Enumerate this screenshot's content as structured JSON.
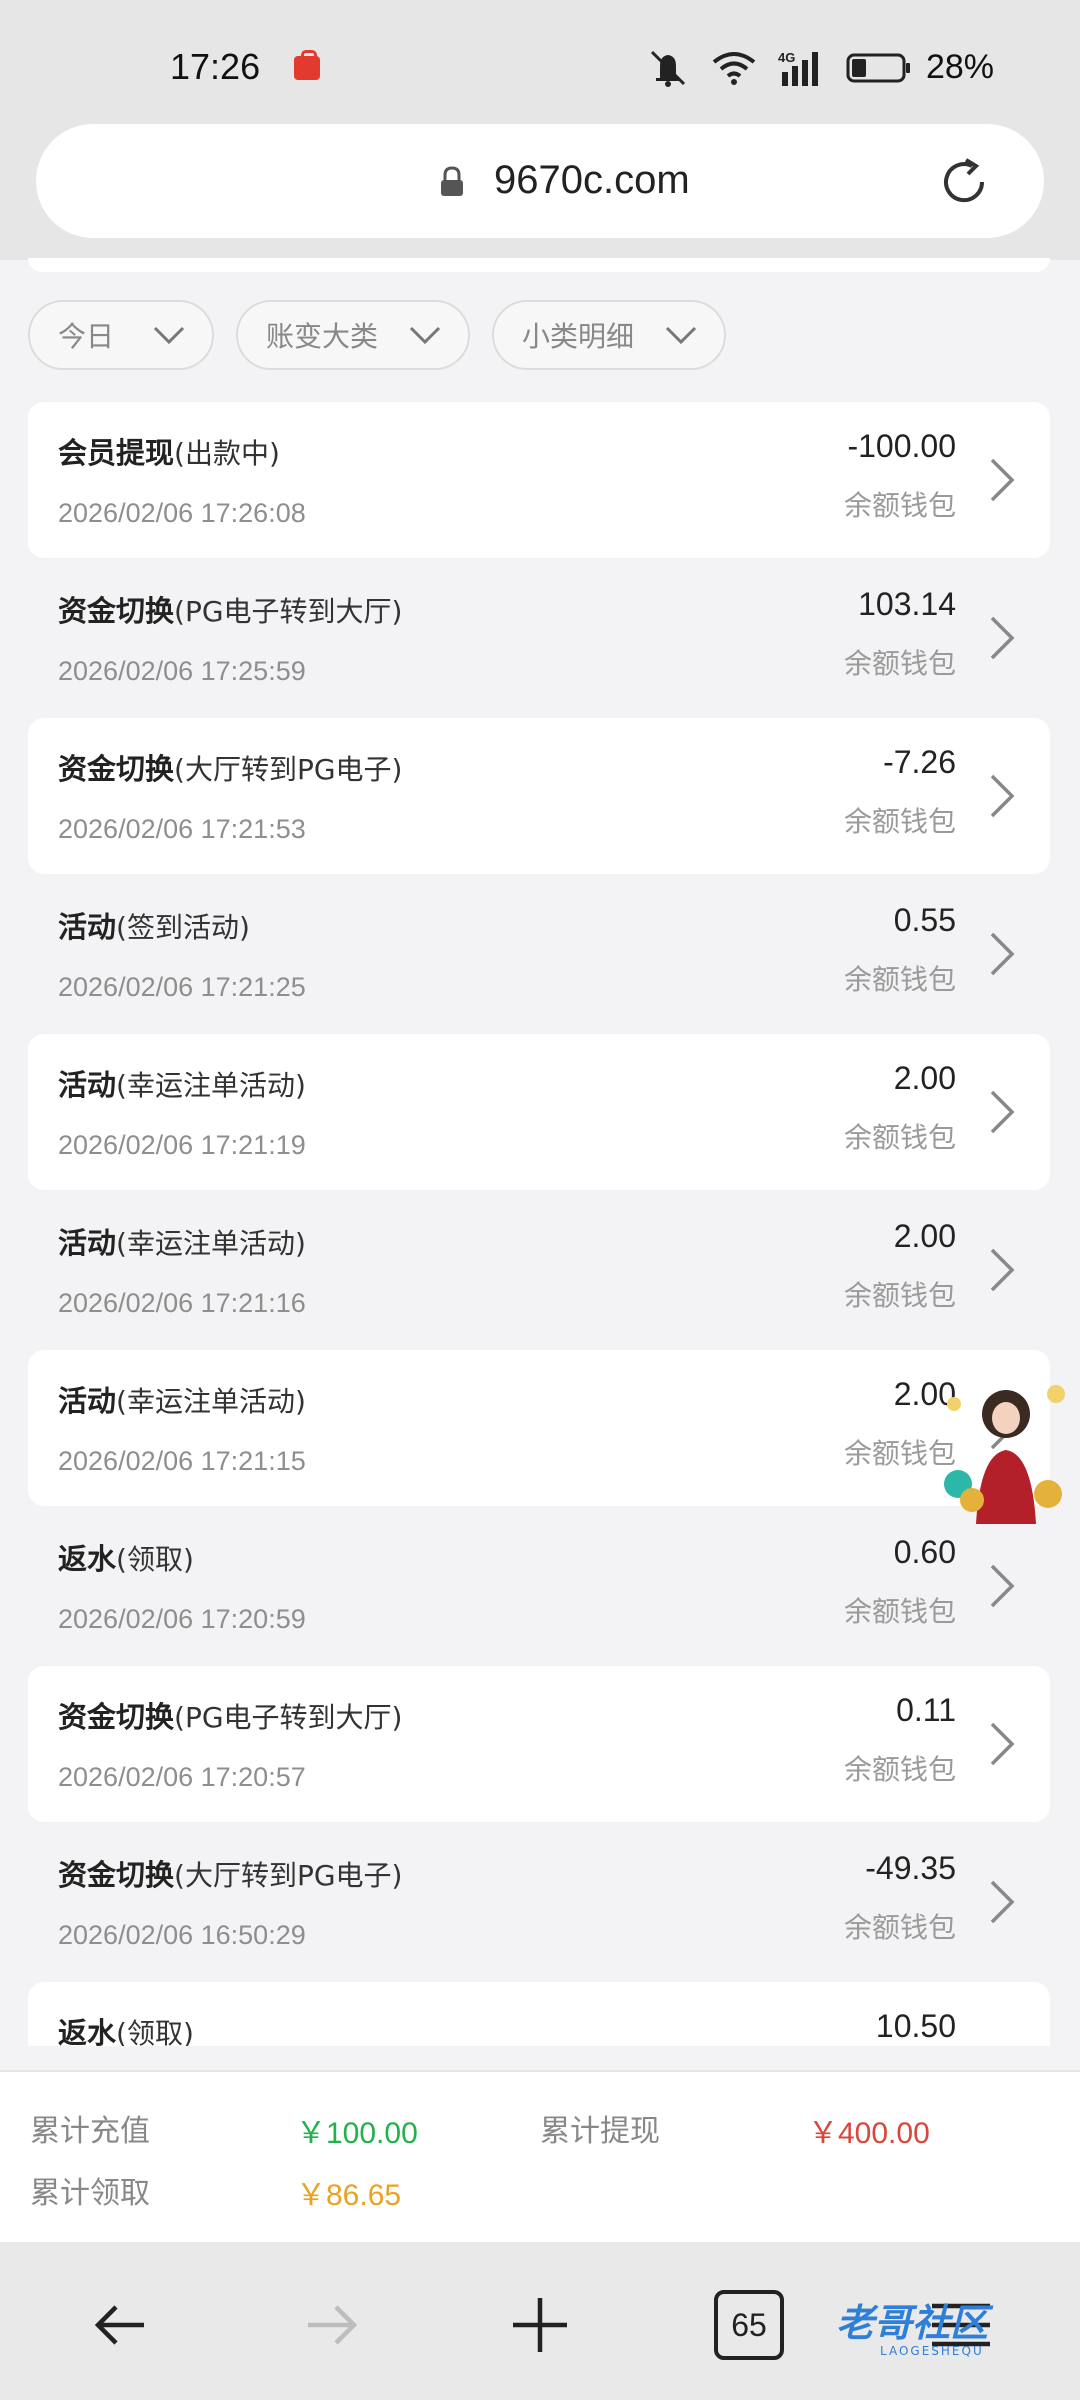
{
  "status_bar": {
    "time": "17:26",
    "battery": "28%",
    "network": "4G"
  },
  "browser": {
    "url": "9670c.com",
    "tab_count": "65"
  },
  "filters": [
    {
      "label": "今日"
    },
    {
      "label": "账变大类"
    },
    {
      "label": "小类明细"
    }
  ],
  "records": [
    {
      "title": "会员提现",
      "sub": "(出款中)",
      "date": "2026/02/06 17:26:08",
      "amount": "-100.00",
      "wallet": "余额钱包"
    },
    {
      "title": "资金切换",
      "sub": "(PG电子转到大厅)",
      "date": "2026/02/06 17:25:59",
      "amount": "103.14",
      "wallet": "余额钱包"
    },
    {
      "title": "资金切换",
      "sub": "(大厅转到PG电子)",
      "date": "2026/02/06 17:21:53",
      "amount": "-7.26",
      "wallet": "余额钱包"
    },
    {
      "title": "活动",
      "sub": "(签到活动)",
      "date": "2026/02/06 17:21:25",
      "amount": "0.55",
      "wallet": "余额钱包"
    },
    {
      "title": "活动",
      "sub": "(幸运注单活动)",
      "date": "2026/02/06 17:21:19",
      "amount": "2.00",
      "wallet": "余额钱包"
    },
    {
      "title": "活动",
      "sub": "(幸运注单活动)",
      "date": "2026/02/06 17:21:16",
      "amount": "2.00",
      "wallet": "余额钱包"
    },
    {
      "title": "活动",
      "sub": "(幸运注单活动)",
      "date": "2026/02/06 17:21:15",
      "amount": "2.00",
      "wallet": "余额钱包"
    },
    {
      "title": "返水",
      "sub": "(领取)",
      "date": "2026/02/06 17:20:59",
      "amount": "0.60",
      "wallet": "余额钱包"
    },
    {
      "title": "资金切换",
      "sub": "(PG电子转到大厅)",
      "date": "2026/02/06 17:20:57",
      "amount": "0.11",
      "wallet": "余额钱包"
    },
    {
      "title": "资金切换",
      "sub": "(大厅转到PG电子)",
      "date": "2026/02/06 16:50:29",
      "amount": "-49.35",
      "wallet": "余额钱包"
    },
    {
      "title": "返水",
      "sub": "(领取)",
      "date": "",
      "amount": "10.50",
      "wallet": ""
    }
  ],
  "summary": {
    "recharge_label": "累计充值",
    "recharge_value": "￥100.00",
    "withdraw_label": "累计提现",
    "withdraw_value": "￥400.00",
    "claim_label": "累计领取",
    "claim_value": "￥86.65"
  },
  "watermark": {
    "text": "老哥社区",
    "sub": "LAOGESHEQU"
  },
  "colors": {
    "recharge": "#22b14c",
    "withdraw": "#d9463b",
    "claim": "#e9a321"
  }
}
